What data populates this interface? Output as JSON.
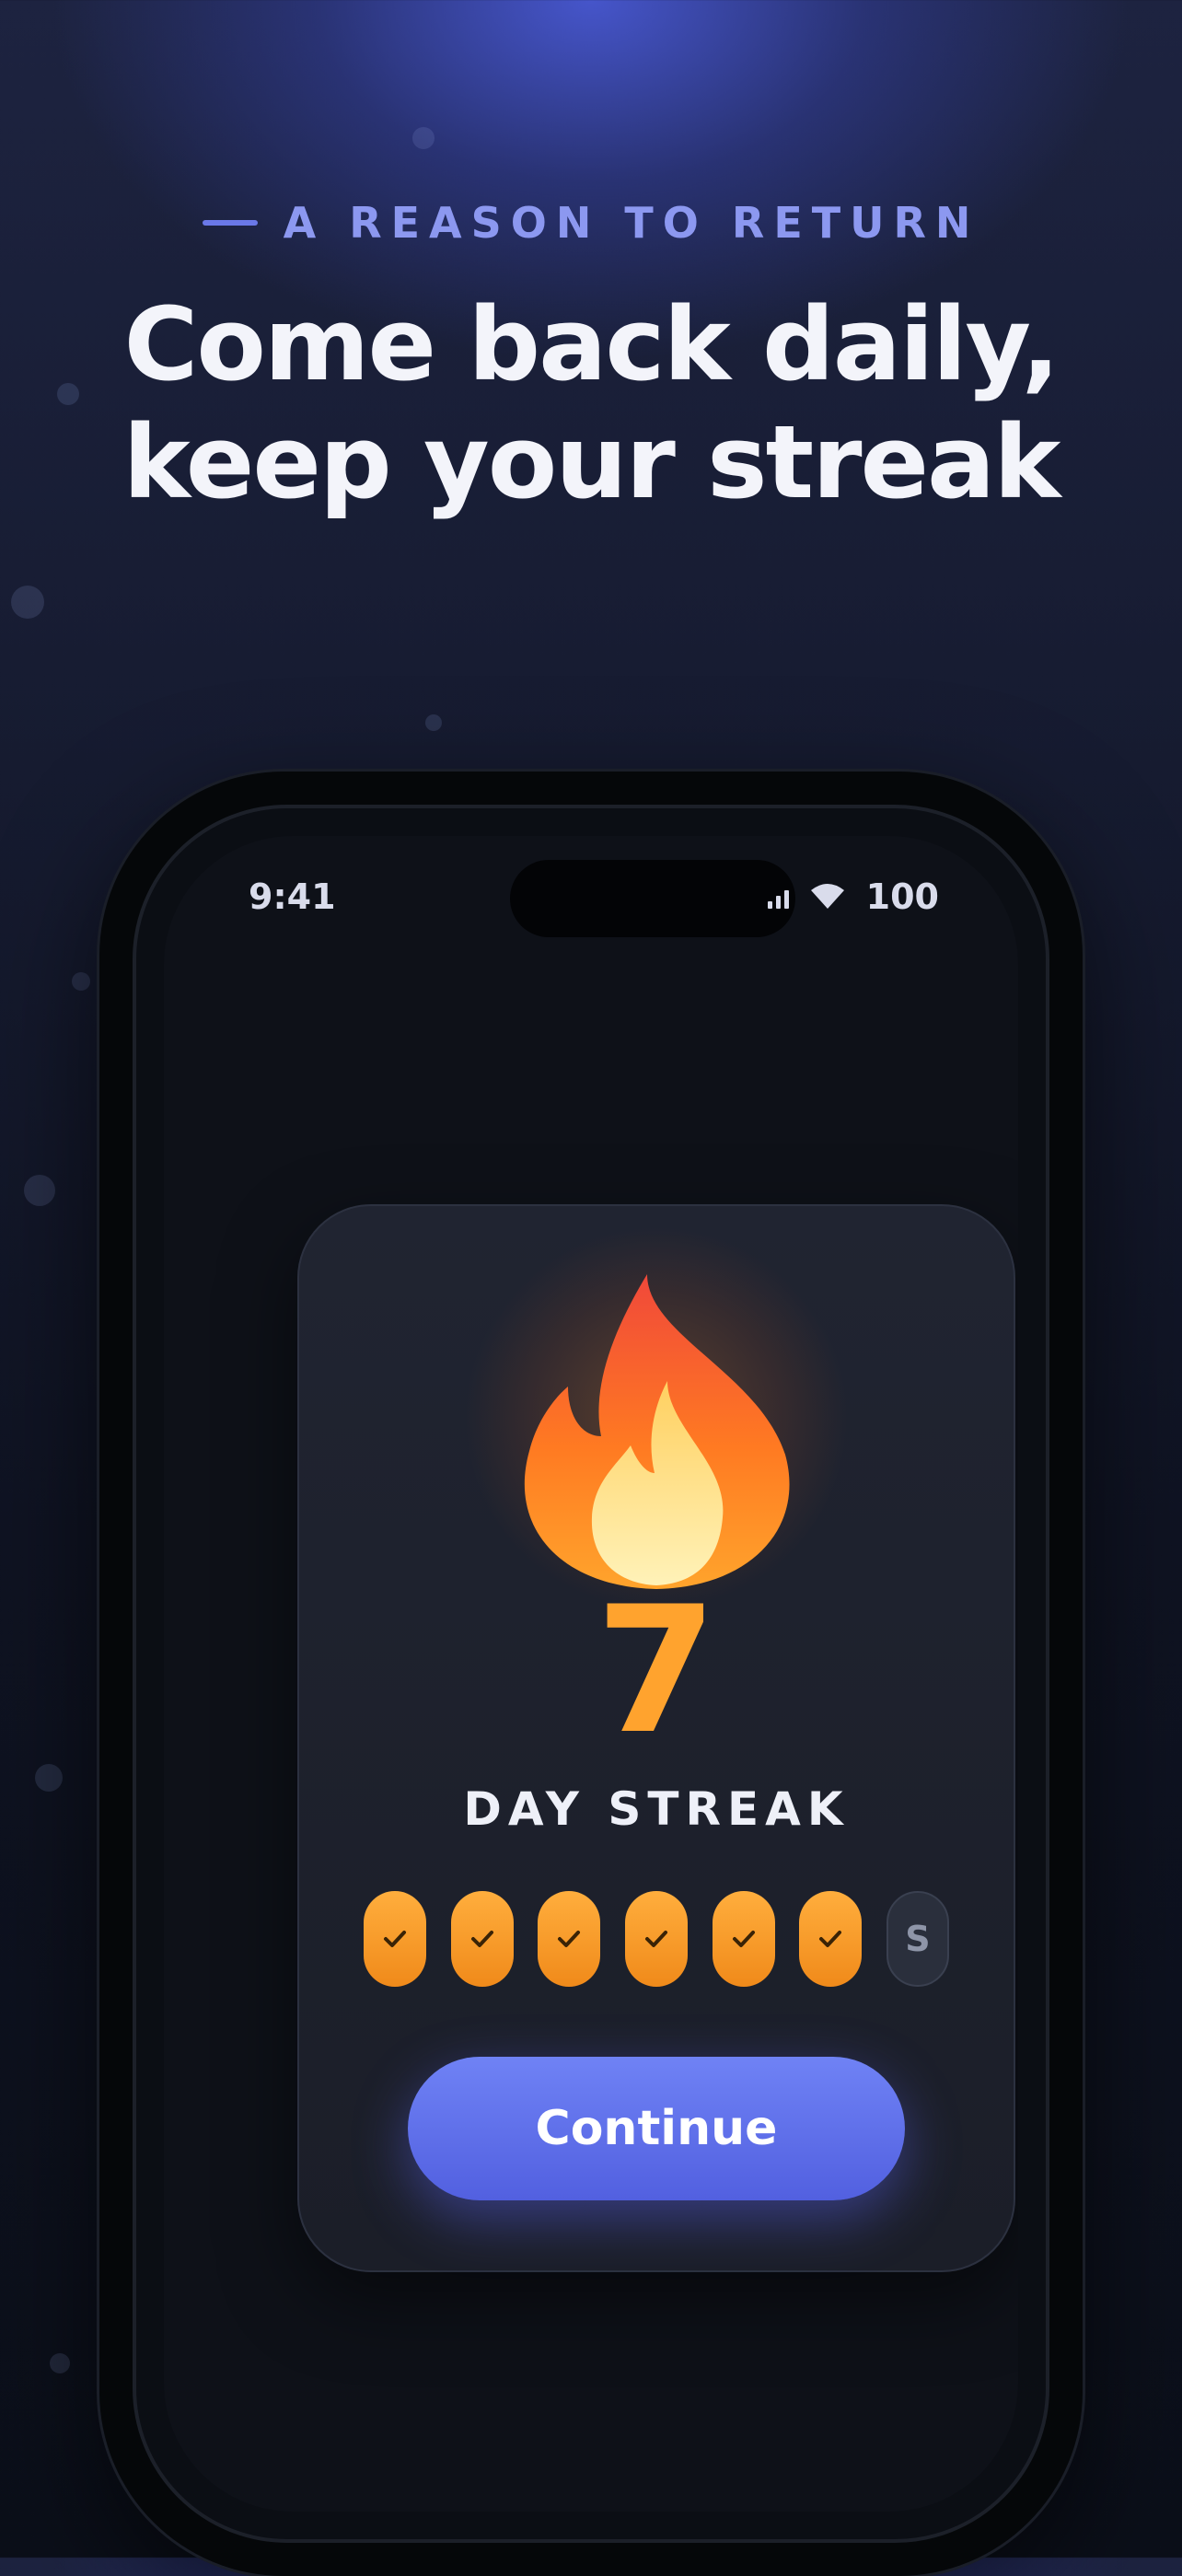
{
  "eyebrow": "A REASON TO RETURN",
  "headline": {
    "line1": "Come back daily,",
    "line2": "keep your streak"
  },
  "status_bar": {
    "time": "9:41",
    "battery": "100"
  },
  "streak": {
    "count": "7",
    "label": "DAY STREAK",
    "days": [
      {
        "state": "done",
        "icon": "check-icon"
      },
      {
        "state": "done",
        "icon": "check-icon"
      },
      {
        "state": "done",
        "icon": "check-icon"
      },
      {
        "state": "done",
        "icon": "check-icon"
      },
      {
        "state": "done",
        "icon": "check-icon"
      },
      {
        "state": "done",
        "icon": "check-icon"
      },
      {
        "state": "pending",
        "letter": "S"
      }
    ],
    "icon": "fire-icon",
    "accent_color": "#ffa32e"
  },
  "continue_button": {
    "label": "Continue",
    "color": "#5c6cf0"
  }
}
